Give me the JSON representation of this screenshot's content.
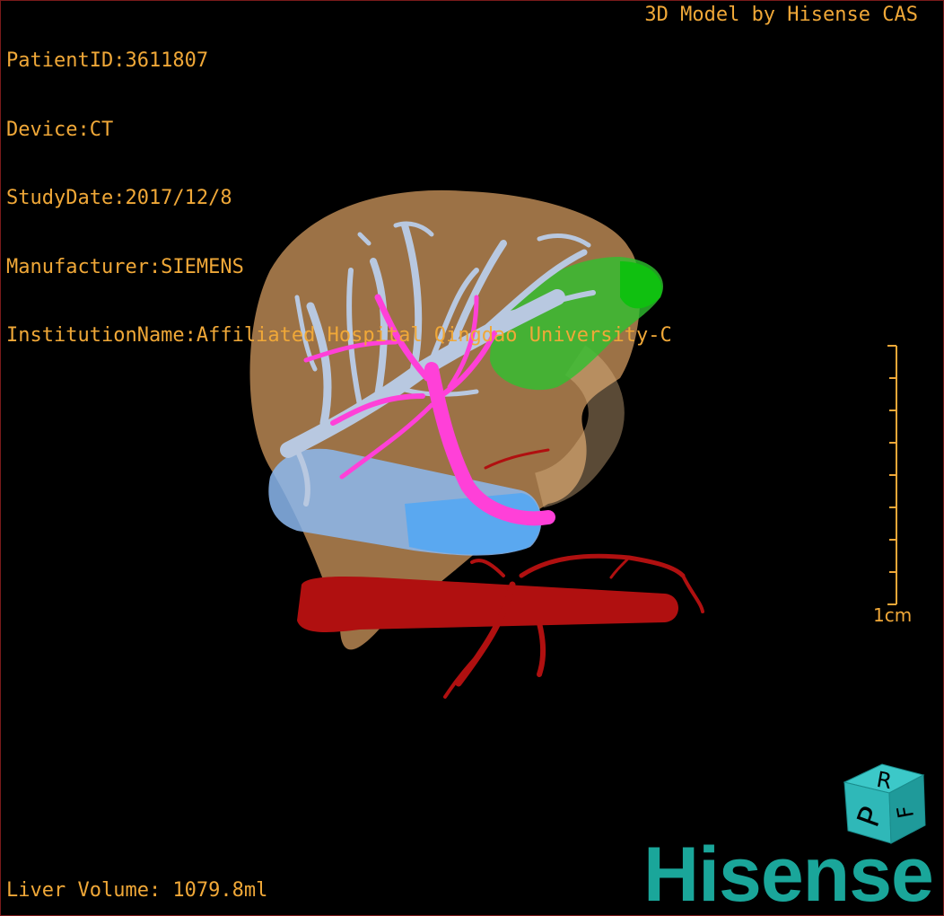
{
  "info": {
    "patient_id": "PatientID:3611807",
    "device": "Device:CT",
    "study_date": "StudyDate:2017/12/8",
    "manufacturer": "Manufacturer:SIEMENS",
    "institution": "InstitutionName:Affiliated Hospital Qingdao University-C"
  },
  "caption": "3D Model by Hisense CAS",
  "scale": {
    "label": "1cm"
  },
  "volume": "Liver Volume: 1079.8ml",
  "logo": "Hisense",
  "cube_faces": {
    "front": "P",
    "top": "R",
    "side": "F"
  },
  "colors": {
    "text": "#f0a838",
    "liver": "#c8925a",
    "hepatic_veins": "#b8c8e0",
    "portal_vein": "#ff40d8",
    "gallbladder": "#30c030",
    "cava": "#6aa8e8",
    "aorta": "#b01010",
    "logo": "#1aa69a"
  }
}
